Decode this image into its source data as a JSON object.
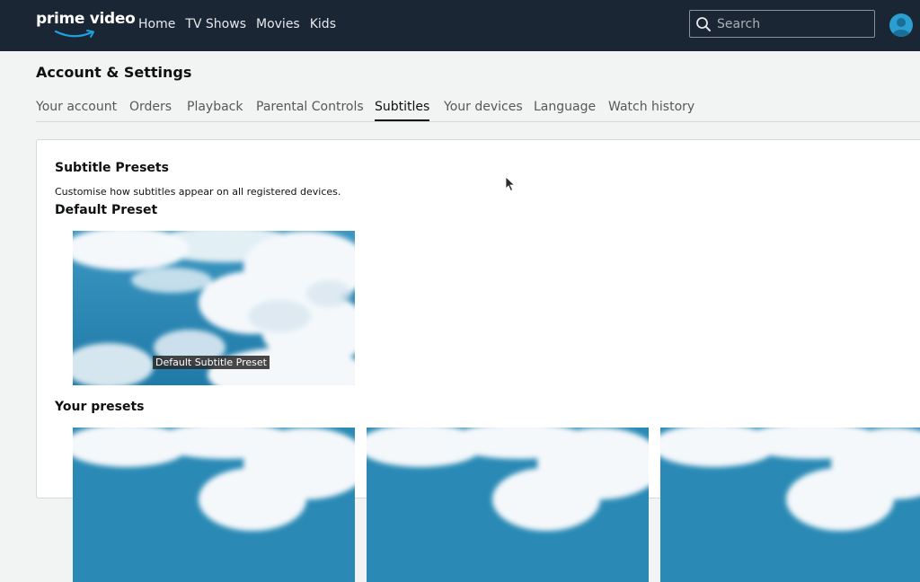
{
  "header": {
    "logo_text": "prime video",
    "nav": [
      "Home",
      "TV Shows",
      "Movies",
      "Kids"
    ],
    "search": {
      "placeholder": "Search",
      "value": ""
    }
  },
  "page": {
    "title": "Account & Settings",
    "tabs": [
      {
        "label": "Your account",
        "active": false
      },
      {
        "label": "Orders",
        "active": false
      },
      {
        "label": "Playback",
        "active": false
      },
      {
        "label": "Parental Controls",
        "active": false
      },
      {
        "label": "Subtitles",
        "active": true
      },
      {
        "label": "Your devices",
        "active": false
      },
      {
        "label": "Language",
        "active": false
      },
      {
        "label": "Watch history",
        "active": false
      }
    ]
  },
  "subtitles": {
    "section_title": "Subtitle Presets",
    "description": "Customise how subtitles appear on all registered devices.",
    "default_heading": "Default Preset",
    "default_preset_caption": "Default Subtitle Preset",
    "your_presets_heading": "Your presets",
    "your_presets_count_visible": 3
  },
  "colors": {
    "header_bg": "#1a2633",
    "page_bg": "#f2f3f3",
    "sky_blue": "#2a8ab5"
  },
  "icons": [
    "search-icon",
    "avatar-icon",
    "prime-smile-logo",
    "mouse-pointer"
  ]
}
